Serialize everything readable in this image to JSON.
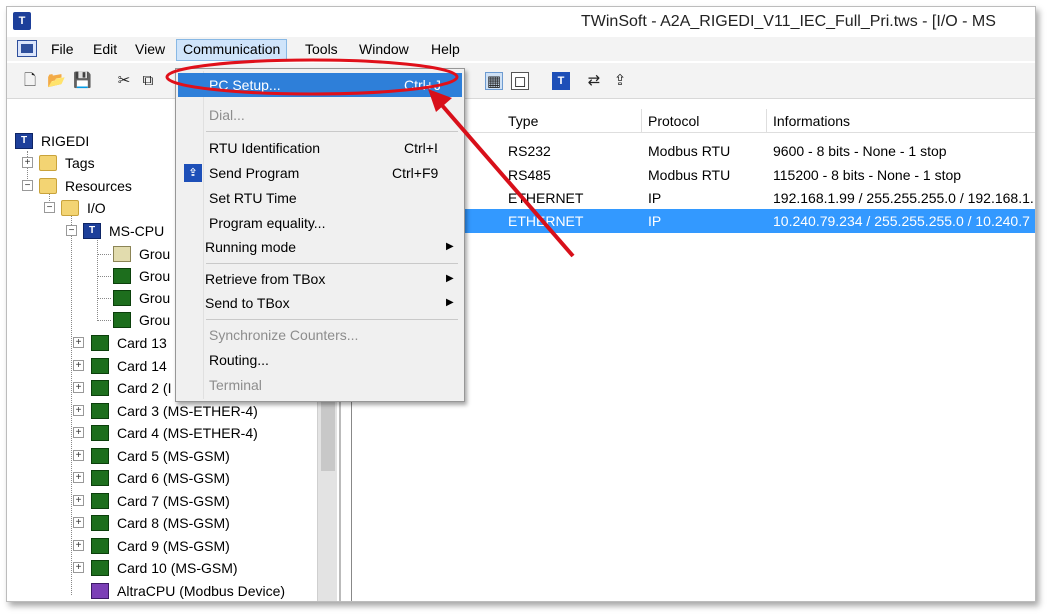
{
  "window": {
    "title": "TWinSoft - A2A_RIGEDI_V11_IEC_Full_Pri.tws  - [I/O - MS"
  },
  "menubar": {
    "items": [
      "File",
      "Edit",
      "View",
      "Communication",
      "Tools",
      "Window",
      "Help"
    ],
    "active": "Communication"
  },
  "dropdown": {
    "pc_setup": "PC Setup...",
    "pc_setup_shortcut": "Ctrl+J",
    "dial": "Dial...",
    "rtu_identification": "RTU Identification",
    "rtu_identification_shortcut": "Ctrl+I",
    "send_program": "Send Program",
    "send_program_shortcut": "Ctrl+F9",
    "set_rtu_time": "Set RTU Time",
    "program_equality": "Program equality...",
    "running_mode": "Running mode",
    "retrieve_from_tbox": "Retrieve from TBox",
    "send_to_tbox": "Send to TBox",
    "synchronize_counters": "Synchronize Counters...",
    "routing": "Routing...",
    "terminal": "Terminal"
  },
  "tree": {
    "root": "RIGEDI",
    "tags": "Tags",
    "resources": "Resources",
    "io": "I/O",
    "ms_cpu": "MS-CPU",
    "group1": "Grou",
    "group2": "Grou",
    "group3": "Grou",
    "group4": "Grou",
    "card13": "Card 13",
    "card14": "Card 14",
    "card2": "Card 2 (I",
    "card3": "Card 3 (MS-ETHER-4)",
    "card4": "Card 4 (MS-ETHER-4)",
    "card5": "Card 5 (MS-GSM)",
    "card6": "Card 6 (MS-GSM)",
    "card7": "Card 7 (MS-GSM)",
    "card8": "Card 8 (MS-GSM)",
    "card9": "Card 9 (MS-GSM)",
    "card10": "Card 10 (MS-GSM)",
    "altracpu": "AltraCPU (Modbus Device)"
  },
  "list": {
    "columns": [
      "Type",
      "Protocol",
      "Informations"
    ],
    "rows": [
      {
        "type": "RS232",
        "protocol": "Modbus RTU",
        "info": "9600 - 8 bits - None - 1 stop"
      },
      {
        "type": "RS485",
        "protocol": "Modbus RTU",
        "info": "115200 - 8 bits - None - 1 stop"
      },
      {
        "type": "ETHERNET",
        "protocol": "IP",
        "info": "192.168.1.99 / 255.255.255.0 / 192.168.1."
      },
      {
        "type": "ETHERNET",
        "protocol": "IP",
        "info": "10.240.79.234 / 255.255.255.0 / 10.240.7"
      }
    ],
    "selected_row": 3
  },
  "colors": {
    "highlight_ellipse": "#e0101a",
    "arrow": "#d8101a",
    "selection": "#3399ff",
    "menu_hot": "#2e7fd9"
  }
}
